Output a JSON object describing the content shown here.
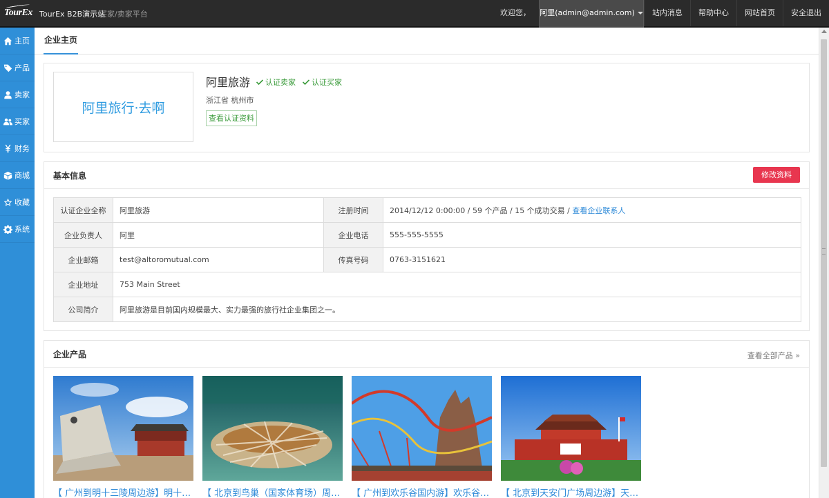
{
  "app": {
    "logo_text": "TourEx",
    "site_name": "TourEx B2B演示站",
    "site_subtitle": "买家/卖家平台"
  },
  "topnav": {
    "welcome": "欢迎您，",
    "user": "阿里(admin@admin.com)",
    "links": [
      "站内消息",
      "帮助中心",
      "网站首页",
      "安全退出"
    ]
  },
  "sidebar": {
    "items": [
      {
        "label": "主页",
        "icon": "home-icon"
      },
      {
        "label": "产品",
        "icon": "tag-icon"
      },
      {
        "label": "卖家",
        "icon": "user-icon"
      },
      {
        "label": "买家",
        "icon": "users-icon"
      },
      {
        "label": "财务",
        "icon": "yen-icon"
      },
      {
        "label": "商城",
        "icon": "box-icon"
      },
      {
        "label": "收藏",
        "icon": "star-icon"
      },
      {
        "label": "系统",
        "icon": "gear-icon"
      }
    ]
  },
  "tabs": {
    "active": "企业主页"
  },
  "company": {
    "logo_text": "阿里旅行·去啊",
    "name": "阿里旅游",
    "badge_seller": "认证卖家",
    "badge_buyer": "认证买家",
    "location": "浙江省 杭州市",
    "view_cert": "查看认证资料"
  },
  "basic": {
    "title": "基本信息",
    "edit_label": "修改资料",
    "rows": {
      "full_name_label": "认证企业全称",
      "full_name_value": "阿里旅游",
      "reg_time_label": "注册时间",
      "reg_time_value": "2014/12/12 0:00:00 / 59 个产品 / 15 个成功交易 /",
      "view_contacts": "查看企业联系人",
      "owner_label": "企业负责人",
      "owner_value": "阿里",
      "phone_label": "企业电话",
      "phone_value": "555-555-5555",
      "email_label": "企业邮箱",
      "email_value": "test@altoromutual.com",
      "fax_label": "传真号码",
      "fax_value": "0763-3151621",
      "address_label": "企业地址",
      "address_value": "753 Main Street",
      "intro_label": "公司简介",
      "intro_value": "阿里旅游是目前国内规模最大、实力最强的旅行社企业集团之一。"
    }
  },
  "products": {
    "title": "企业产品",
    "more": "查看全部产品",
    "items": [
      {
        "name": "【 广州到明十三陵周边游】明十三陵一日游"
      },
      {
        "name": "【 北京到鸟巢（国家体育场）周边游】"
      },
      {
        "name": "【 广州到欢乐谷国内游】欢乐谷一日游"
      },
      {
        "name": "【 北京到天安门广场周边游】天安门"
      }
    ]
  },
  "colors": {
    "topbar": "#2b2b2b",
    "sidebar": "#2f8fd8",
    "accent": "#3591d9",
    "danger": "#e8364f",
    "success": "#3a9b3a"
  }
}
